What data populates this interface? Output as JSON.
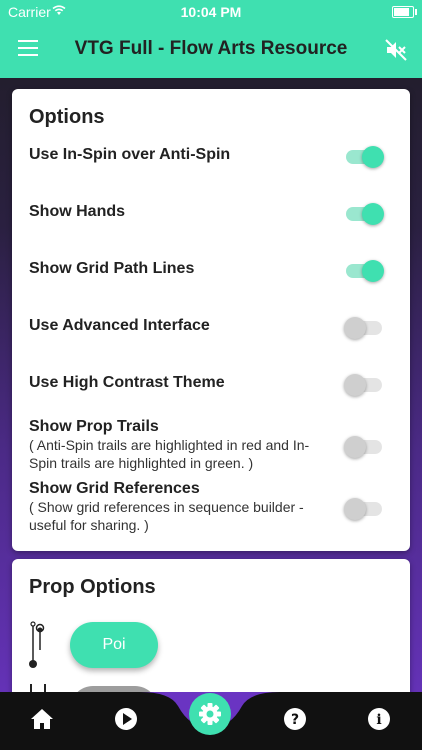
{
  "status_bar": {
    "carrier": "Carrier",
    "time": "10:04 PM"
  },
  "app_bar": {
    "title": "VTG Full - Flow Arts Resource",
    "menu_icon": "hamburger-menu-icon",
    "mute_icon": "volume-muted-icon"
  },
  "options_card": {
    "heading": "Options",
    "items": [
      {
        "label": "Use In-Spin over Anti-Spin",
        "on": true
      },
      {
        "label": "Show Hands",
        "on": true
      },
      {
        "label": "Show Grid Path Lines",
        "on": true
      },
      {
        "label": "Use Advanced Interface",
        "on": false
      },
      {
        "label": "Use High Contrast Theme",
        "on": false
      },
      {
        "label": "Show Prop Trails",
        "description": "( Anti-Spin trails are highlighted in red and In-Spin trails are highlighted in green. )",
        "on": false
      },
      {
        "label": "Show Grid References",
        "description": "( Show grid references in sequence builder - useful for sharing. )",
        "on": false
      }
    ]
  },
  "prop_options_card": {
    "heading": "Prop Options",
    "selected_prop": "Poi",
    "prop_icon": "poi-prop-icon"
  },
  "bottom_nav": {
    "items": [
      "home-icon",
      "play-icon",
      "settings-icon",
      "help-icon",
      "info-icon"
    ]
  },
  "colors": {
    "accent": "#3fe0b0",
    "switch_on_track": "#9ae7cf",
    "switch_off_track": "#e4e4e4",
    "nav_background": "#111111",
    "background_purple": "#6a34c2"
  }
}
